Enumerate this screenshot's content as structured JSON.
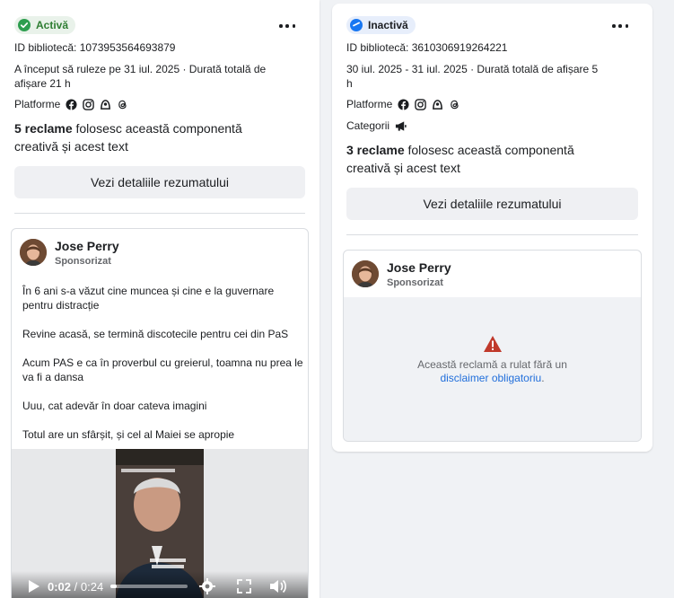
{
  "left": {
    "status": "Activă",
    "library_id": "ID bibliotecă: 1073953564693879",
    "run_line1": "A început să ruleze pe 31 iul. 2025 · Durată totală de",
    "run_line2": "afișare 21 h",
    "platforms_label": "Platforme",
    "platforms": [
      "facebook-icon",
      "instagram-icon",
      "audience-network-icon",
      "threads-icon"
    ],
    "count_bold": "5 reclame",
    "count_rest": " folosesc această componentă",
    "count_line2": "creativă și acest text",
    "summary_button": "Vezi detaliile rezumatului",
    "ad": {
      "page_name": "Jose Perry",
      "sponsored": "Sponsorizat",
      "p1_l1": "În 6 ani s-a văzut cine muncea și cine e la guvernare",
      "p1_l2": "pentru distracție",
      "p2": "Revine acasă, se termină discotecile pentru cei din PaS",
      "p3_l1": "Acum PAS e ca în proverbul cu greierul, toamna nu prea le",
      "p3_l2": "va fi a dansa",
      "p4": "Uuu, cat adevăr în doar cateva imagini",
      "p5": "Totul are un sfârșit, și cel al Maiei se apropie",
      "video": {
        "current_time": "0:02",
        "duration": " / 0:24",
        "progress": 0.08
      }
    }
  },
  "right": {
    "status": "Inactivă",
    "library_id": "ID bibliotecă: 3610306919264221",
    "run_line1": "30 iul. 2025 - 31 iul. 2025 · Durată totală de afișare 5",
    "run_line2": "h",
    "platforms_label": "Platforme",
    "platforms": [
      "facebook-icon",
      "instagram-icon",
      "audience-network-icon",
      "threads-icon"
    ],
    "categories_label": "Categorii",
    "categories_icon": "megaphone-icon",
    "count_bold": "3 reclame",
    "count_rest": " folosesc această componentă",
    "count_line2": "creativă și acest text",
    "summary_button": "Vezi detaliile rezumatului",
    "ad": {
      "page_name": "Jose Perry",
      "sponsored": "Sponsorizat",
      "warning_line1": "Această reclamă a rulat fără un",
      "warning_link": "disclaimer obligatoriu",
      "warning_end": "."
    }
  },
  "colors": {
    "active_green": "#2e9e4f",
    "inactive_blue": "#1877f2",
    "warning_red": "#c0392b",
    "link_blue": "#216fdb"
  }
}
